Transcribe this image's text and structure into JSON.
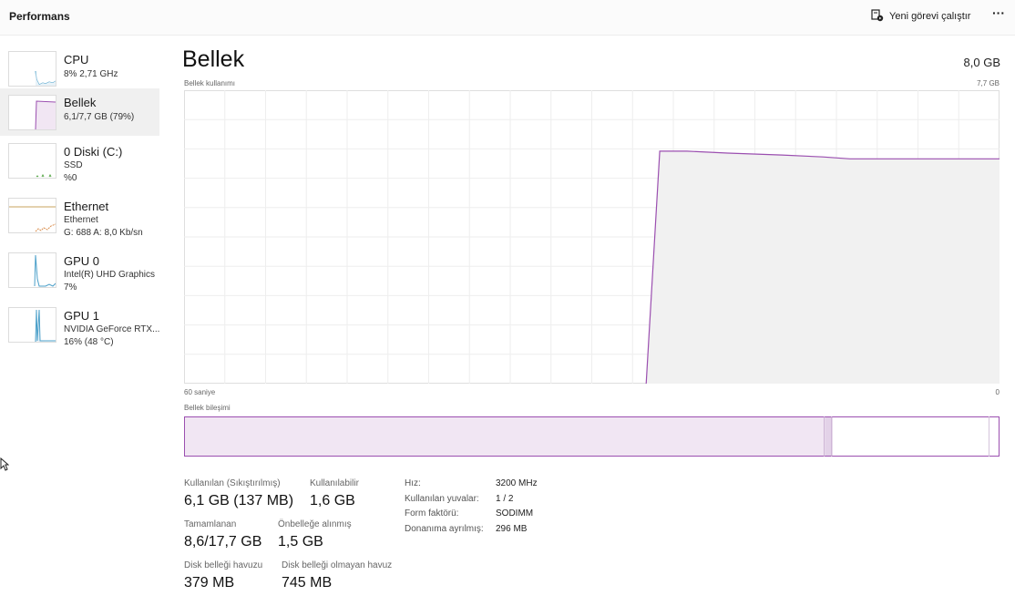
{
  "header": {
    "title": "Performans",
    "run_task_label": "Yeni görevi çalıştır",
    "more_label": "···"
  },
  "sidebar": {
    "items": [
      {
        "name": "CPU",
        "line1": "8% 2,71 GHz",
        "line2": ""
      },
      {
        "name": "Bellek",
        "line1": "6,1/7,7 GB (79%)",
        "line2": ""
      },
      {
        "name": "0 Diski (C:)",
        "line1": "SSD",
        "line2": "%0"
      },
      {
        "name": "Ethernet",
        "line1": "Ethernet",
        "line2": "G: 688 A: 8,0 Kb/sn"
      },
      {
        "name": "GPU 0",
        "line1": "Intel(R) UHD Graphics",
        "line2": "7%"
      },
      {
        "name": "GPU 1",
        "line1": "NVIDIA GeForce RTX...",
        "line2": "16% (48 °C)"
      }
    ]
  },
  "main": {
    "title": "Bellek",
    "total": "8,0 GB",
    "graph_label": "Bellek kullanımı",
    "graph_max": "7,7 GB",
    "time_left": "60 saniye",
    "time_right": "0",
    "composition_label": "Bellek bileşimi"
  },
  "stats": {
    "used_label": "Kullanılan (Sıkıştırılmış)",
    "used_value": "6,1 GB (137 MB)",
    "available_label": "Kullanılabilir",
    "available_value": "1,6 GB",
    "committed_label": "Tamamlanan",
    "committed_value": "8,6/17,7 GB",
    "cached_label": "Önbelleğe alınmış",
    "cached_value": "1,5 GB",
    "paged_label": "Disk belleği havuzu",
    "paged_value": "379 MB",
    "nonpaged_label": "Disk belleği olmayan havuz",
    "nonpaged_value": "745 MB"
  },
  "specs": [
    {
      "label": "Hız:",
      "value": "3200 MHz"
    },
    {
      "label": "Kullanılan yuvalar:",
      "value": "1 / 2"
    },
    {
      "label": "Form faktörü:",
      "value": "SODIMM"
    },
    {
      "label": "Donanıma ayrılmış:",
      "value": "296 MB"
    }
  ],
  "chart_data": {
    "type": "area",
    "ylim": [
      0,
      7.7
    ],
    "xlim": [
      60,
      0
    ],
    "x": [
      60,
      26,
      25,
      23,
      20,
      16,
      13,
      11,
      0
    ],
    "y": [
      0,
      0,
      6.1,
      6.1,
      6.05,
      6.0,
      5.95,
      5.9,
      5.9
    ],
    "composition": {
      "used_gb": 6.1,
      "modified_gb": 0.07,
      "standby_gb": 1.5,
      "free_gb": 0.1
    },
    "colors": {
      "line": "#9b4fb0",
      "fill": "#f1f1f1",
      "composition_fill": "#f1e6f3",
      "border": "#9b4fb0"
    }
  }
}
